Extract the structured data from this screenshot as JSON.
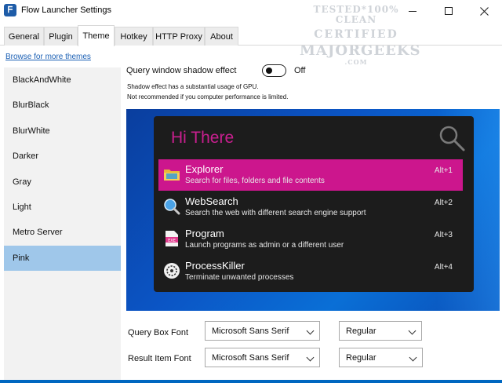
{
  "window": {
    "title": "Flow Launcher Settings",
    "icon_color": "#1e5ca8"
  },
  "watermark": {
    "line1": "TESTED*100% CLEAN",
    "line2": "CERTIFIED",
    "line3": "MAJORGEEKS",
    "line4": ".COM"
  },
  "tabs": [
    {
      "label": "General",
      "active": false
    },
    {
      "label": "Plugin",
      "active": false
    },
    {
      "label": "Theme",
      "active": true
    },
    {
      "label": "Hotkey",
      "active": false
    },
    {
      "label": "HTTP Proxy",
      "active": false
    },
    {
      "label": "About",
      "active": false
    }
  ],
  "sidebar": {
    "browse_link": "Browse for more themes",
    "themes": [
      "BlackAndWhite",
      "BlurBlack",
      "BlurWhite",
      "Darker",
      "Gray",
      "Light",
      "Metro Server",
      "Pink"
    ],
    "selected": "Pink",
    "selected_color": "#9fc7ea"
  },
  "shadow": {
    "label": "Query window shadow effect",
    "state": "Off",
    "note_line1": "Shadow effect has a substantial usage of GPU.",
    "note_line2": "Not recommended if you computer performance is limited."
  },
  "preview": {
    "query": "Hi There",
    "accent_color": "#cc168d",
    "results": [
      {
        "icon": "folder-icon",
        "title": "Explorer",
        "subtitle": "Search for files, folders and file contents",
        "hotkey": "Alt+1",
        "selected": true
      },
      {
        "icon": "magnifier-globe-icon",
        "title": "WebSearch",
        "subtitle": "Search the web with different search engine support",
        "hotkey": "Alt+2",
        "selected": false
      },
      {
        "icon": "exe-file-icon",
        "title": "Program",
        "subtitle": "Launch programs as admin or a different user",
        "hotkey": "Alt+3",
        "selected": false
      },
      {
        "icon": "process-killer-icon",
        "title": "ProcessKiller",
        "subtitle": "Terminate unwanted processes",
        "hotkey": "Alt+4",
        "selected": false
      }
    ]
  },
  "fonts": {
    "query_box": {
      "label": "Query Box Font",
      "family": "Microsoft Sans Serif",
      "style": "Regular"
    },
    "result_item": {
      "label": "Result Item Font",
      "family": "Microsoft Sans Serif",
      "style": "Regular"
    }
  }
}
